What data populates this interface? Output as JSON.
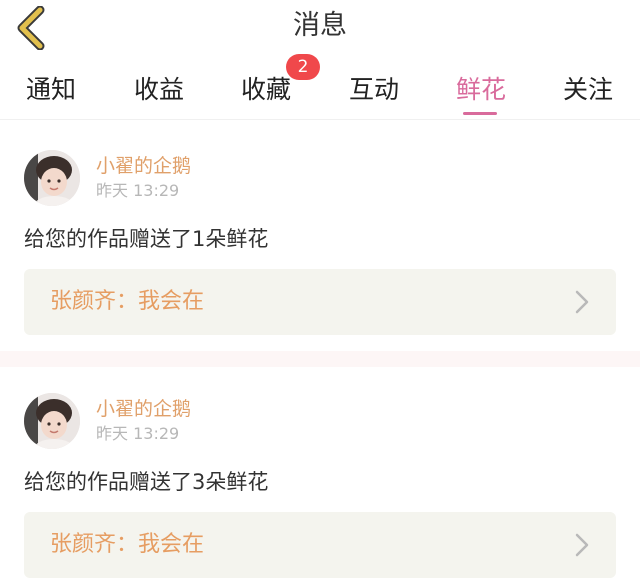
{
  "header": {
    "title": "消息",
    "back_icon": "chevron-left-icon"
  },
  "tabs": [
    {
      "label": "通知",
      "active": false
    },
    {
      "label": "收益",
      "active": false
    },
    {
      "label": "收藏",
      "active": false,
      "badge": "2"
    },
    {
      "label": "互动",
      "active": false
    },
    {
      "label": "鲜花",
      "active": true
    },
    {
      "label": "关注",
      "active": false
    }
  ],
  "feed": [
    {
      "user": "小翟的企鹅",
      "time": "昨天 13:29",
      "message": "给您的作品赠送了1朵鲜花",
      "quote": "张颜齐：我会在"
    },
    {
      "user": "小翟的企鹅",
      "time": "昨天 13:29",
      "message": "给您的作品赠送了3朵鲜花",
      "quote": "张颜齐：我会在"
    }
  ],
  "colors": {
    "accent": "#d96b9c",
    "badge": "#f0484b",
    "username": "#e0a06a",
    "quote_text": "#e69d62",
    "back_arrow": "#e2c04d"
  }
}
